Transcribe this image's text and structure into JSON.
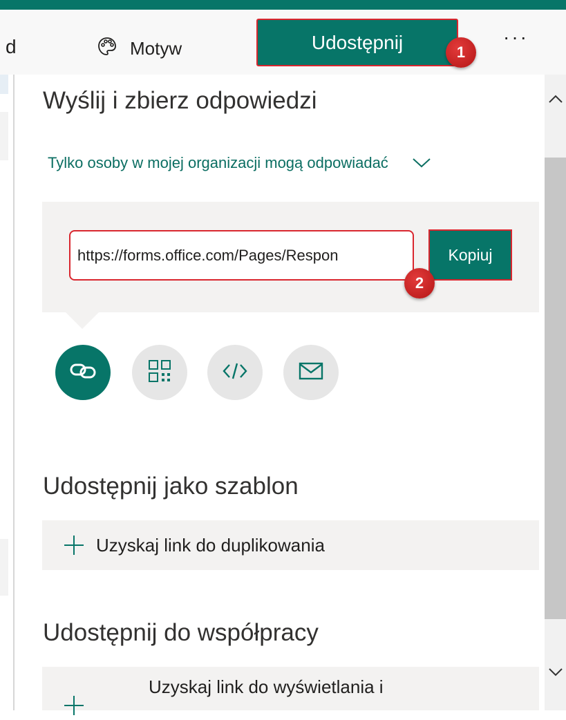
{
  "toolbar": {
    "partial_label": "d",
    "theme_label": "Motyw",
    "share_label": "Udostępnij",
    "more_label": "···"
  },
  "badges": {
    "one": "1",
    "two": "2"
  },
  "send": {
    "heading": "Wyślij i zbierz odpowiedzi",
    "permission": "Tylko osoby w mojej organizacji mogą odpowiadać",
    "link_value": "https://forms.office.com/Pages/Respon",
    "copy_label": "Kopiuj",
    "methods": [
      "link-icon",
      "qr-code-icon",
      "embed-code-icon",
      "email-icon"
    ]
  },
  "template": {
    "heading": "Udostępnij jako szablon",
    "action": "Uzyskaj link do duplikowania"
  },
  "collab": {
    "heading": "Udostępnij do współpracy",
    "action": "Uzyskaj link do wyświetlania i"
  },
  "colors": {
    "accent": "#077568",
    "highlight": "#d9262e",
    "panel_bg": "#f3f2f1"
  }
}
